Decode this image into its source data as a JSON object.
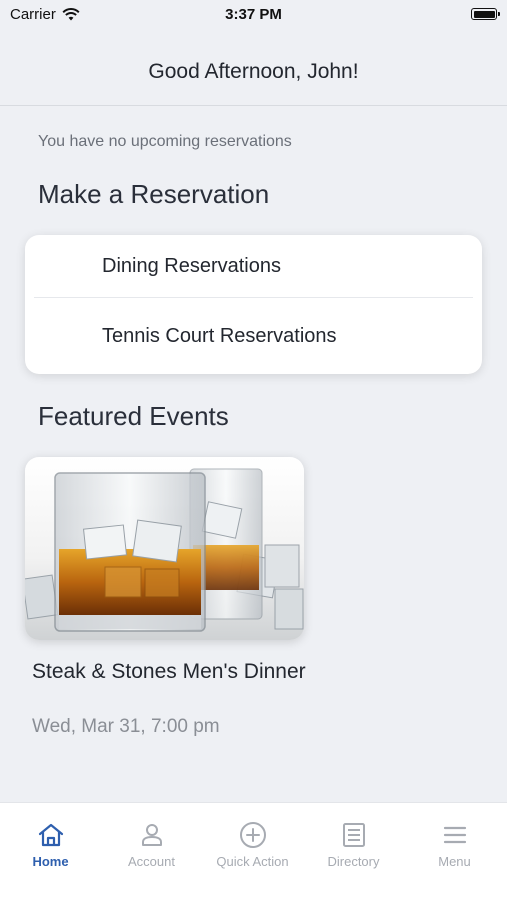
{
  "status_bar": {
    "carrier": "Carrier",
    "time": "3:37 PM"
  },
  "header": {
    "greeting": "Good Afternoon, John!"
  },
  "reservations": {
    "empty_message": "You have no upcoming reservations",
    "section_title": "Make a Reservation",
    "items": [
      {
        "label": "Dining Reservations"
      },
      {
        "label": "Tennis Court Reservations"
      }
    ]
  },
  "events": {
    "section_title": "Featured Events",
    "items": [
      {
        "title": "Steak & Stones Men's Dinner",
        "date": "Wed, Mar 31, 7:00 pm",
        "image": "whiskey-glasses-on-ice"
      }
    ]
  },
  "tab_bar": {
    "active_color": "#2e5fae",
    "inactive_color": "#a7abb2",
    "tabs": [
      {
        "label": "Home",
        "icon": "home-icon",
        "active": true
      },
      {
        "label": "Account",
        "icon": "person-icon",
        "active": false
      },
      {
        "label": "Quick Action",
        "icon": "plus-circle-icon",
        "active": false
      },
      {
        "label": "Directory",
        "icon": "list-icon",
        "active": false
      },
      {
        "label": "Menu",
        "icon": "hamburger-icon",
        "active": false
      }
    ]
  }
}
